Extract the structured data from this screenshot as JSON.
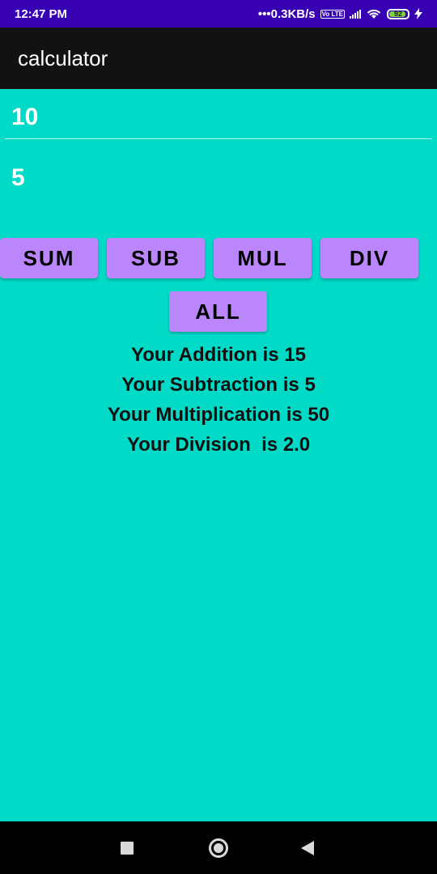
{
  "status_bar": {
    "time": "12:47 PM",
    "network_speed": "•••0.3KB/s",
    "volte": "Vo LTE",
    "battery": "92",
    "battery_level_percent": 92
  },
  "app_bar": {
    "title": "calculator"
  },
  "inputs": {
    "first_value": "10",
    "second_value": "5"
  },
  "buttons": {
    "sum_label": "SUM",
    "sub_label": "SUB",
    "mul_label": "MUL",
    "div_label": "DIV",
    "all_label": "ALL"
  },
  "results": {
    "addition": "Your Addition is 15",
    "subtraction": "Your Subtraction is 5",
    "multiplication": "Your Multiplication is 50",
    "division": "Your Division  is 2.0"
  },
  "colors": {
    "background": "#00DAC6",
    "status_bar": "#3700B3",
    "app_bar": "#121212",
    "button": "#BB86FC"
  }
}
